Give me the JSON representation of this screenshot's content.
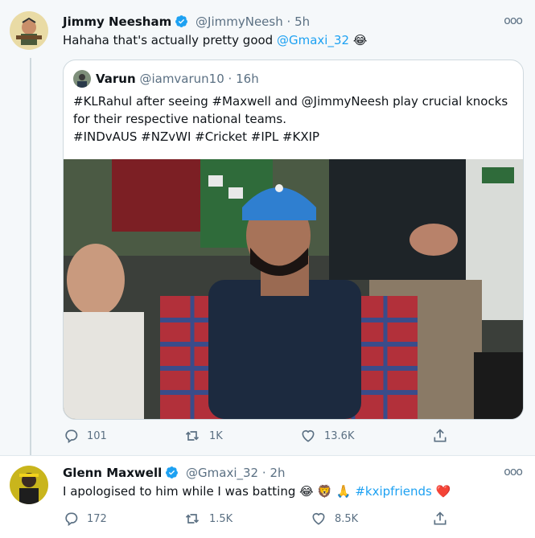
{
  "tweet1": {
    "name": "Jimmy Neesham",
    "handle": "@JimmyNeesh",
    "sep": "·",
    "time": "5h",
    "more": "ooo",
    "text_pre": "Hahaha that's actually pretty good ",
    "mention": "@Gmaxi_32",
    "emoji": "😂",
    "quote": {
      "name": "Varun",
      "handle": "@iamvarun10",
      "sep": "·",
      "time": "16h",
      "line1": "#KLRahul after seeing #Maxwell and @JimmyNeesh play crucial knocks",
      "line2": "for their respective national teams.",
      "line3": "#INDvAUS #NZvWI #Cricket #IPL #KXIP"
    },
    "replies": "101",
    "retweets": "1K",
    "likes": "13.6K"
  },
  "tweet2": {
    "name": "Glenn Maxwell",
    "handle": "@Gmaxi_32",
    "sep": "·",
    "time": "2h",
    "more": "ooo",
    "text_pre": "I apologised to him while I was batting ",
    "emojis": "😂 🦁 🙏",
    "hashtag": "#kxipfriends",
    "heart": "❤️",
    "replies": "172",
    "retweets": "1.5K",
    "likes": "8.5K"
  },
  "colors": {
    "accent": "#1da1f2",
    "muted": "#5b7083",
    "heart": "#e0245e"
  },
  "icons": [
    "verified-icon",
    "more-icon",
    "reply-icon",
    "retweet-icon",
    "like-icon",
    "share-icon"
  ]
}
